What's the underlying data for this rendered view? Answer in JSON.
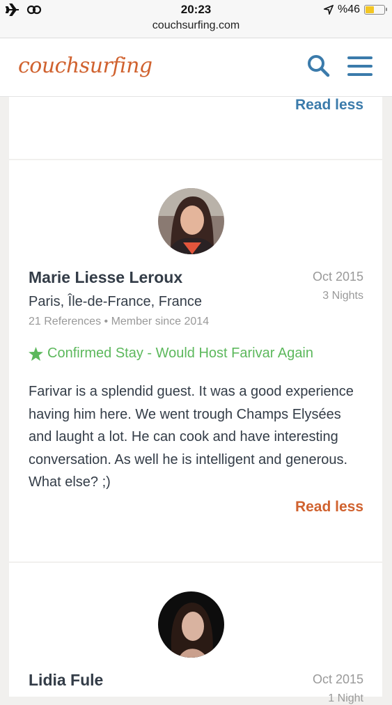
{
  "status_bar": {
    "time": "20:23",
    "url": "couchsurfing.com",
    "battery": "%46",
    "battery_level": 0.46,
    "battery_color": "#f3c623"
  },
  "header": {
    "logo": "couchsurfing",
    "logo_color": "#d0622f",
    "icon_color": "#3b7bab"
  },
  "references": [
    {
      "read_less": "Read less",
      "read_less_color": "#3b7bab"
    },
    {
      "name": "Marie Liesse Leroux",
      "date": "Oct 2015",
      "nights": "3 Nights",
      "location": "Paris, Île-de-France, France",
      "references": "21 References",
      "member_since": "Member since 2014",
      "confirmed": "Confirmed Stay - Would Host Farivar Again",
      "text": "Farivar is a splendid guest. It was a good experience having him here. We went trough Champs Elysées and laught a lot. He can cook and have interesting conversation. As well he is intelligent and generous. What else? ;)",
      "read_less": "Read less",
      "read_less_color": "#d0622f"
    },
    {
      "name": "Lidia Fule",
      "date": "Oct 2015",
      "nights": "1 Night"
    }
  ]
}
